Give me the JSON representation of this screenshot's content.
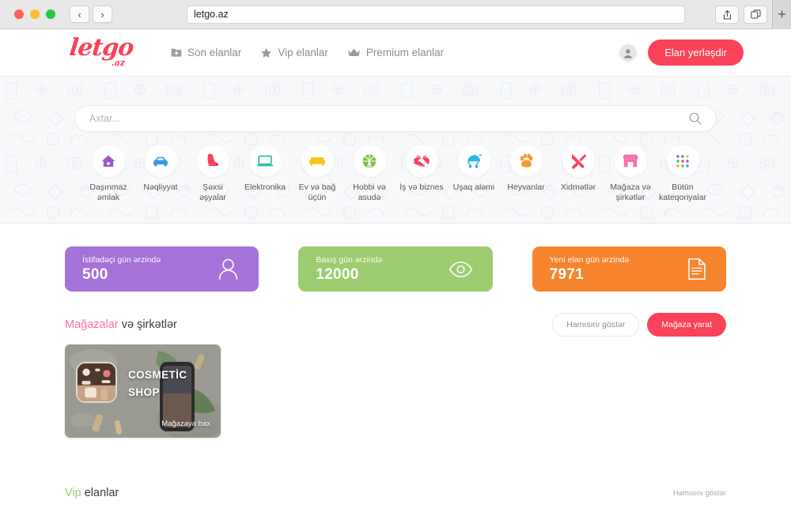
{
  "browser": {
    "url": "letgo.az",
    "back_icon": "chevron-left-icon",
    "forward_icon": "chevron-right-icon",
    "share_icon": "share-icon",
    "tabs_icon": "tab-overview-icon",
    "new_tab_label": "+"
  },
  "header": {
    "logo_text": "letgo",
    "logo_suffix": ".az",
    "nav": [
      {
        "label": "Son elanlar",
        "icon": "folder-plus-icon"
      },
      {
        "label": "Vip elanlar",
        "icon": "star-icon"
      },
      {
        "label": "Premium elanlar",
        "icon": "crown-icon"
      }
    ],
    "avatar_icon": "user-avatar-icon",
    "post_ad_label": "Elan yerləşdir"
  },
  "search": {
    "placeholder": "Axtar...",
    "value": "",
    "icon": "search-icon"
  },
  "categories": [
    {
      "label": "Daşınmaz əmlak",
      "icon": "house-icon",
      "color": "#9b59d0"
    },
    {
      "label": "Nəqliyyat",
      "icon": "car-icon",
      "color": "#3b9ae1"
    },
    {
      "label": "Şəxsi əşyalar",
      "icon": "high-heel-icon",
      "color": "#f8405c"
    },
    {
      "label": "Elektronika",
      "icon": "laptop-icon",
      "color": "#2bbfa0"
    },
    {
      "label": "Ev və bağ üçün",
      "icon": "sofa-icon",
      "color": "#f5c518"
    },
    {
      "label": "Hobbi və asudə",
      "icon": "basketball-icon",
      "color": "#7cc144"
    },
    {
      "label": "İş və biznes",
      "icon": "handshake-icon",
      "color": "#f8405c"
    },
    {
      "label": "Uşaq aləmi",
      "icon": "stroller-icon",
      "color": "#2bb6e8"
    },
    {
      "label": "Heyvanlar",
      "icon": "paw-icon",
      "color": "#f79a34"
    },
    {
      "label": "Xidmətlər",
      "icon": "tools-icon",
      "color": "#f8405c"
    },
    {
      "label": "Mağaza və şirkətlər",
      "icon": "store-icon",
      "color": "#f771ad"
    },
    {
      "label": "Bütün kateqoriyalar",
      "icon": "grid-dots-icon",
      "color": "#9b59d0"
    }
  ],
  "stats": [
    {
      "label": "İstifadəçi gün ərzində",
      "value": "500",
      "color": "#a472d8",
      "icon": "user-outline-icon"
    },
    {
      "label": "Baxış gün ərzində",
      "value": "12000",
      "color": "#9ccc6f",
      "icon": "eye-outline-icon"
    },
    {
      "label": "Yeni elan gün ərzində",
      "value": "7971",
      "color": "#f6842c",
      "icon": "document-outline-icon"
    }
  ],
  "stores_section": {
    "title_accent": "Mağazalar",
    "title_rest": " və şirkətlər",
    "show_all_label": "Hamısını göstər",
    "create_store_label": "Mağaza yarat",
    "cards": [
      {
        "name_line1": "COSMETİC",
        "name_line2": "SHOP",
        "cta": "Mağazaya bax"
      }
    ]
  },
  "vip_section": {
    "title_accent": "Vip",
    "title_rest": " elanlar",
    "show_all_label": "Hamısını göstər"
  }
}
